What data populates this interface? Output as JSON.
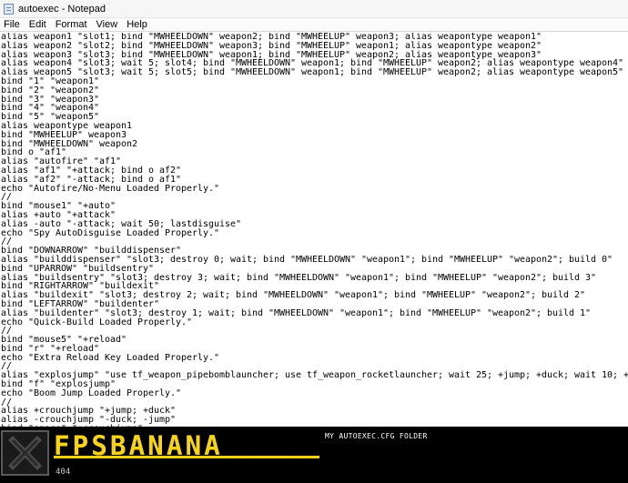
{
  "window": {
    "title": "autoexec - Notepad"
  },
  "menu": {
    "items": [
      "File",
      "Edit",
      "Format",
      "View",
      "Help"
    ]
  },
  "editor": {
    "lines": [
      "alias weapon1 \"slot1; bind \"MWHEELDOWN\" weapon2; bind \"MWHEELUP\" weapon3; alias weapontype weapon1\"",
      "alias weapon2 \"slot2; bind \"MWHEELDOWN\" weapon3; bind \"MWHEELUP\" weapon1; alias weapontype weapon2\"",
      "alias weapon3 \"slot3; bind \"MWHEELDOWN\" weapon1; bind \"MWHEELUP\" weapon2; alias weapontype weapon3\"",
      "alias weapon4 \"slot3; wait 5; slot4; bind \"MWHEELDOWN\" weapon1; bind \"MWHEELUP\" weapon2; alias weapontype weapon4\"",
      "alias weapon5 \"slot3; wait 5; slot5; bind \"MWHEELDOWN\" weapon1; bind \"MWHEELUP\" weapon2; alias weapontype weapon5\"",
      "bind \"1\" \"weapon1\"",
      "bind \"2\" \"weapon2\"",
      "bind \"3\" \"weapon3\"",
      "bind \"4\" \"weapon4\"",
      "bind \"5\" \"weapon5\"",
      "alias weapontype weapon1",
      "bind \"MWHEELUP\" weapon3",
      "bind \"MWHEELDOWN\" weapon2",
      "bind o \"af1\"",
      "alias \"autofire\" \"af1\"",
      "alias \"af1\" \"+attack; bind o af2\"",
      "alias \"af2\" \"-attack; bind o af1\"",
      "echo \"Autofire/No-Menu Loaded Properly.\"",
      "//",
      "bind \"mouse1\" \"+auto\"",
      "alias +auto \"+attack\"",
      "alias -auto \"-attack; wait 50; lastdisguise\"",
      "echo \"Spy AutoDisguise Loaded Properly.\"",
      "//",
      "bind \"DOWNARROW\" \"builddispenser\"",
      "alias \"builddispenser\" \"slot3; destroy 0; wait; bind \"MWHEELDOWN\" \"weapon1\"; bind \"MWHEELUP\" \"weapon2\"; build 0\"",
      "bind \"UPARROW\" \"buildsentry\"",
      "alias \"buildsentry\" \"slot3; destroy 3; wait; bind \"MWHEELDOWN\" \"weapon1\"; bind \"MWHEELUP\" \"weapon2\"; build 3\"",
      "bind \"RIGHTARROW\" \"buildexit\"",
      "alias \"buildexit\" \"slot3; destroy 2; wait; bind \"MWHEELDOWN\" \"weapon1\"; bind \"MWHEELUP\" \"weapon2\"; build 2\"",
      "bind \"LEFTARROW\" \"buildenter\"",
      "alias \"buildenter\" \"slot3; destroy 1; wait; bind \"MWHEELDOWN\" \"weapon1\"; bind \"MWHEELUP\" \"weapon2\"; build 1\"",
      "echo \"Quick-Build Loaded Properly.\"",
      "//",
      "bind \"mouse5\" \"+reload\"",
      "bind \"r\" \"+reload\"",
      "echo \"Extra Reload Key Loaded Properly.\"",
      "//",
      "alias \"explosjump\" \"use tf_weapon_pipebomblauncher; use tf_weapon_rocketlauncher; wait 25; +jump; +duck; wait 10; +",
      "bind \"f\" \"explosjump\"",
      "echo \"Boom Jump Loaded Properly.\"",
      "//",
      "alias +crouchjump \"+jump; +duck\"",
      "alias -crouchjump \"-duck; -jump\"",
      "bind \"space\" \"+crouchjump\""
    ]
  },
  "banner": {
    "brand": "FPSBANANA",
    "caption": "MY AUTOEXEC.CFG FOLDER",
    "code": "404",
    "brand_color": "#f7d21a"
  }
}
